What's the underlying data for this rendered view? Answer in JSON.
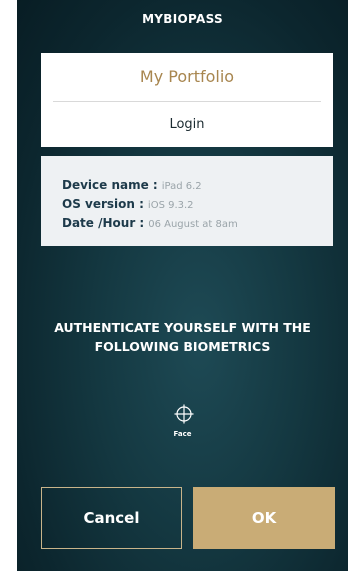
{
  "app": {
    "title": "MYBIOPASS"
  },
  "portfolio": {
    "title": "My Portfolio",
    "login_label": "Login"
  },
  "device": {
    "name_label": "Device name :",
    "name_value": "iPad 6.2",
    "os_label": "OS version :",
    "os_value": "iOS 9.3.2",
    "date_label": "Date /Hour :",
    "date_value": "06 August at 8am"
  },
  "auth": {
    "line1": "AUTHENTICATE YOURSELF WITH THE",
    "line2": "FOLLOWING BIOMETRICS",
    "face_icon": "crosshair-icon",
    "face_label": "Face"
  },
  "buttons": {
    "cancel": "Cancel",
    "ok": "OK"
  },
  "colors": {
    "accent_gold": "#c9ac76",
    "portfolio_title": "#a8864f",
    "background_dark": "#0c262e"
  }
}
